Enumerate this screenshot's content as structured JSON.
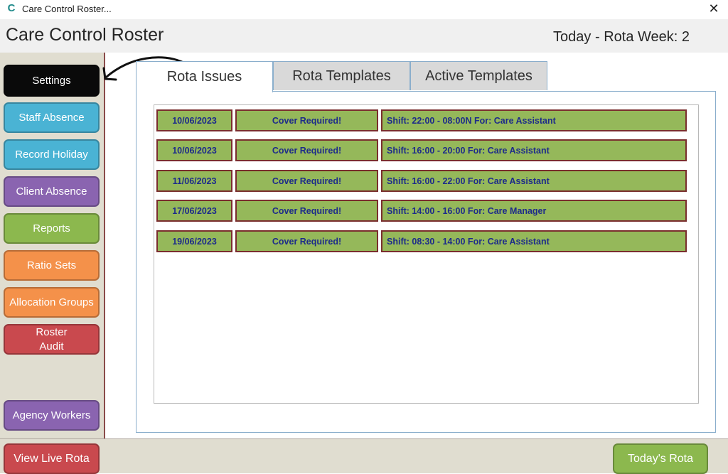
{
  "window": {
    "title": "Care Control Roster...",
    "close_glyph": "✕"
  },
  "header": {
    "app_title": "Care Control Roster",
    "week_label": "Today - Rota Week: 2"
  },
  "sidebar": {
    "items": [
      {
        "label": "Settings",
        "color": "#0a0a0a"
      },
      {
        "label": "Staff Absence",
        "color": "#4ab3d4"
      },
      {
        "label": "Record Holiday",
        "color": "#4ab3d4"
      },
      {
        "label": "Client Absence",
        "color": "#8a64b0"
      },
      {
        "label": "Reports",
        "color": "#8cb84e"
      },
      {
        "label": "Ratio Sets",
        "color": "#f4914a"
      },
      {
        "label": "Allocation Groups",
        "color": "#f4914a"
      },
      {
        "label": "Roster\nAudit",
        "color": "#c9494e"
      },
      {
        "label": "Agency Workers",
        "color": "#8a64b0"
      }
    ]
  },
  "tabs": [
    {
      "label": "Rota Issues",
      "active": true
    },
    {
      "label": "Rota Templates",
      "active": false
    },
    {
      "label": "Active Templates",
      "active": false
    }
  ],
  "rota_issues": [
    {
      "date": "10/06/2023",
      "status": "Cover Required!",
      "shift": "Shift: 22:00 - 08:00N For: Care Assistant"
    },
    {
      "date": "10/06/2023",
      "status": "Cover Required!",
      "shift": "Shift: 16:00 - 20:00 For: Care Assistant"
    },
    {
      "date": "11/06/2023",
      "status": "Cover Required!",
      "shift": "Shift: 16:00 - 22:00 For: Care Assistant"
    },
    {
      "date": "17/06/2023",
      "status": "Cover Required!",
      "shift": "Shift: 14:00 - 16:00 For: Care Manager"
    },
    {
      "date": "19/06/2023",
      "status": "Cover Required!",
      "shift": "Shift: 08:30 - 14:00 For: Care Assistant"
    }
  ],
  "footer": {
    "view_live_rota": "View Live Rota",
    "todays_rota": "Today's Rota"
  },
  "colors": {
    "row_fill": "#95b85a",
    "row_border": "#7a2e2e",
    "row_text": "#1d2b8a",
    "sidebar_bg": "#e0ddd0",
    "view_live_rota_color": "#c9494e",
    "todays_rota_color": "#8cb84e"
  },
  "icons": {
    "app": "care-control-logo-icon",
    "close": "close-icon",
    "arrow": "curved-arrow-icon"
  }
}
